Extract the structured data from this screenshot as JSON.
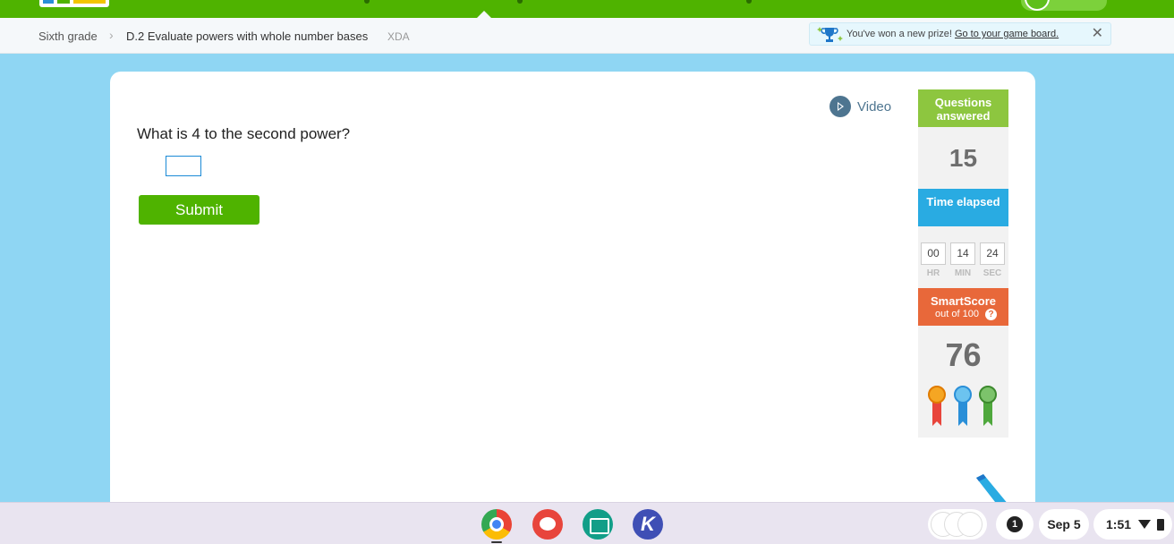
{
  "breadcrumb": {
    "grade": "Sixth grade",
    "separator": "›",
    "skill": "D.2 Evaluate powers with whole number bases",
    "code": "XDA"
  },
  "prize_banner": {
    "message": "You've won a new prize!",
    "link": "Go to your game board.",
    "close": "✕"
  },
  "question": {
    "text": "What is 4 to the second power?",
    "answer_value": "",
    "submit_label": "Submit",
    "video_label": "Video"
  },
  "stats": {
    "questions_answered_label": "Questions answered",
    "questions_answered": "15",
    "time_elapsed_label": "Time elapsed",
    "time": {
      "hr": "00",
      "min": "14",
      "sec": "24"
    },
    "time_units": {
      "hr": "HR",
      "min": "MIN",
      "sec": "SEC"
    },
    "smartscore_label": "SmartScore",
    "smartscore_sub": "out of 100",
    "smartscore_help": "?",
    "smartscore": "76"
  },
  "shelf": {
    "kahoot_glyph": "K",
    "notification_count": "1",
    "date": "Sep 5",
    "time": "1:51"
  },
  "colors": {
    "ixl_green": "#4fb300",
    "answered_green": "#8dc63f",
    "time_blue": "#29abe2",
    "smartscore_orange": "#e8683a",
    "page_background": "#8fd6f3"
  }
}
